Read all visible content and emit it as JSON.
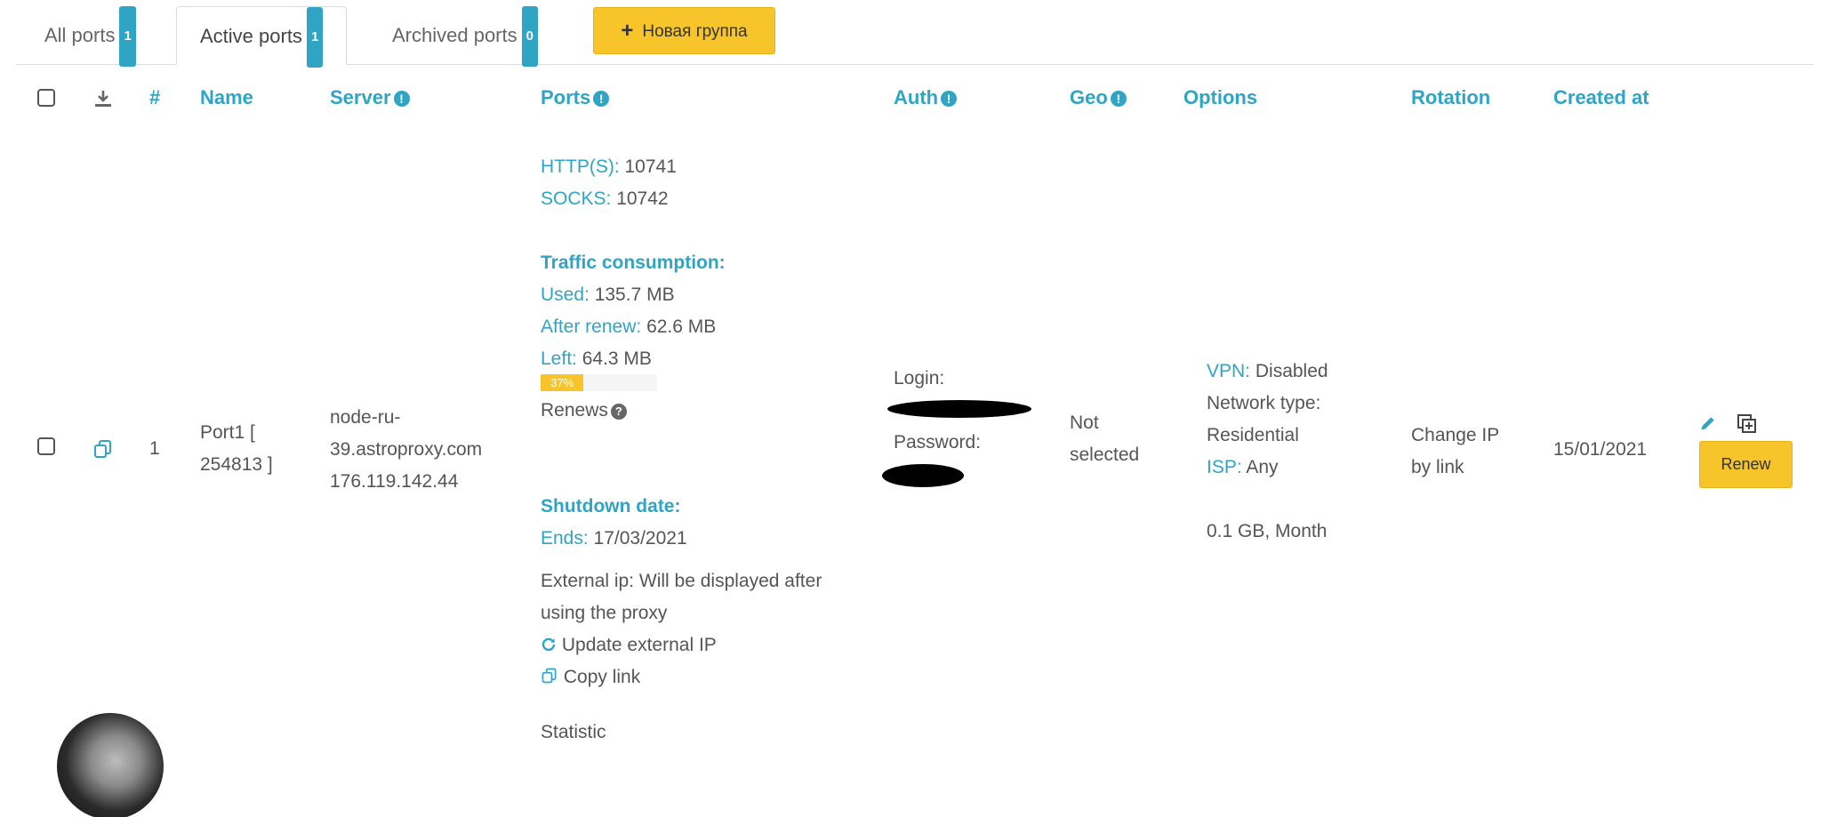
{
  "tabs": [
    {
      "label": "All ports",
      "count": "1"
    },
    {
      "label": "Active ports",
      "count": "1"
    },
    {
      "label": "Archived ports",
      "count": "0"
    }
  ],
  "new_group_label": "Новая группа",
  "headers": {
    "index": "#",
    "name": "Name",
    "server": "Server",
    "ports": "Ports",
    "auth": "Auth",
    "geo": "Geo",
    "options": "Options",
    "rotation": "Rotation",
    "created_at": "Created at"
  },
  "row": {
    "index": "1",
    "name_line1": "Port1 [",
    "name_line2": "254813 ]",
    "server_line1": "node-ru-",
    "server_line2": "39.astroproxy.com",
    "server_ip": "176.119.142.44",
    "ports": {
      "http_label": "HTTP(S):",
      "http_value": "10741",
      "socks_label": "SOCKS:",
      "socks_value": "10742",
      "traffic_title": "Traffic consumption:",
      "used_label": "Used:",
      "used_value": "135.7 MB",
      "after_label": "After renew:",
      "after_value": "62.6 MB",
      "left_label": "Left:",
      "left_value": "64.3 MB",
      "progress_text": "37%",
      "progress_fraction": 0.37,
      "renews_label": "Renews",
      "shutdown_title": "Shutdown date:",
      "ends_label": "Ends:",
      "ends_value": "17/03/2021",
      "external_ip_line1": "External ip: Will be displayed after",
      "external_ip_line2": "using the proxy",
      "update_ip_label": "Update external IP",
      "copy_link_label": "Copy link",
      "statistic_label": "Statistic"
    },
    "auth": {
      "login_label": "Login:",
      "password_label": "Password:"
    },
    "geo_line1": "Not",
    "geo_line2": "selected",
    "options": {
      "vpn_label": "VPN:",
      "vpn_value": "Disabled",
      "network_label": "Network type:",
      "network_value": "Residential",
      "isp_label": "ISP:",
      "isp_value": "Any",
      "plan": "0.1 GB, Month"
    },
    "rotation_line1": "Change IP",
    "rotation_line2": "by link",
    "created_at": "15/01/2021",
    "renew_label": "Renew"
  },
  "colors": {
    "accent": "#2fa4c4",
    "button": "#f7c52a",
    "text": "#555555"
  },
  "icons": [
    "download-icon",
    "copy-icon",
    "info-icon",
    "question-icon",
    "edit-icon",
    "duplicate-icon",
    "refresh-icon",
    "plus-icon"
  ]
}
